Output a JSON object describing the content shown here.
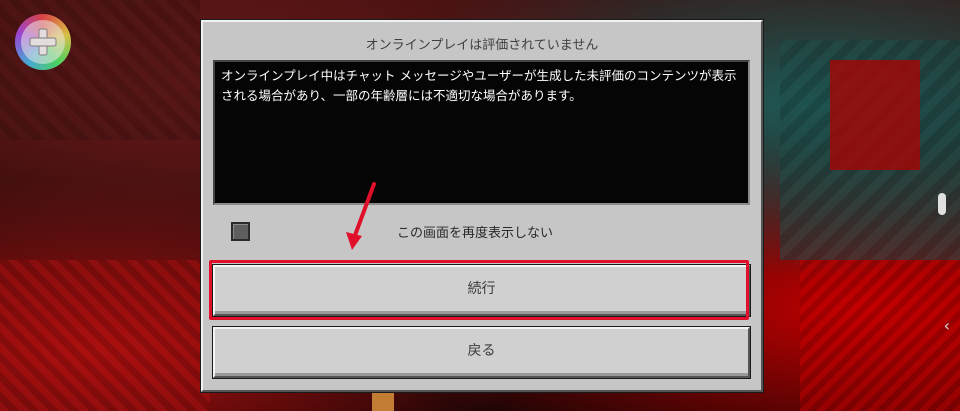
{
  "dialog": {
    "title": "オンラインプレイは評価されていません",
    "message": "オンラインプレイ中はチャット メッセージやユーザーが生成した未評価のコンテンツが表示\nされる場合があり、一部の年齢層には不適切な場合があります。",
    "checkbox_label": "この画面を再度表示しない",
    "checkbox_checked": false,
    "continue_label": "続行",
    "back_label": "戻る"
  },
  "colors": {
    "annotation": "#e0102a",
    "dialog_bg": "#c6c6c6",
    "message_bg": "#050505"
  },
  "icons": {
    "top_left": "gamepad-icon",
    "right_edge": "chevron-left-icon"
  }
}
